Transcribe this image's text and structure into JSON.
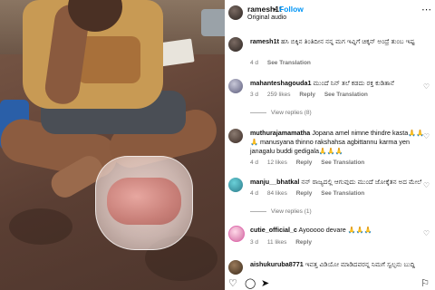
{
  "post": {
    "owner": "ramesh1t",
    "separator": "•",
    "follow_label": "Follow",
    "audio": "Original audio",
    "more_icon": "more-icon"
  },
  "comments": [
    {
      "user": "ramesh1t",
      "text": "ಹಸಿ ಬಿಕ್ಕಿನ ತಿಂತಿದೀನ ನನ್ನ ಮಗ ಇವ್ನಿಗೆ ಚಿಕ್ಕನ್ ಅಂದ್ರೆ ತುಂಬ ಇಷ್ಟ",
      "time": "4 d",
      "likes": "",
      "reply": "",
      "see_translation": "See Translation"
    },
    {
      "user": "mahanteshagouda1",
      "text": "ಮುಂದೆ ನಿನ್ ತಲೆ ಕಡದು ರಕ್ತ ಕುಡಿತಾನೆ",
      "time": "3 d",
      "likes": "259 likes",
      "reply": "Reply",
      "see_translation": "See Translation",
      "view_replies": "View replies (8)"
    },
    {
      "user": "muthurajamamatha",
      "text": "Jopana amel nimne thindre kasta🙏🙏🙏 manusyana thinno rakshahsa agbittannu karma yen janagalu buddi gedigala🙏🙏🙏",
      "time": "4 d",
      "likes": "12 likes",
      "reply": "Reply",
      "see_translation": "See Translation"
    },
    {
      "user": "manju__bhatkal",
      "text": "ನನ್ ರಾಜ್ಯದಲ್ಲಿ ಆಗುವುದು ಮುಂದೆ ಜೋಕ್ಕೆತನ ಅದ ಮೇಲೆ",
      "time": "4 d",
      "likes": "84 likes",
      "reply": "Reply",
      "see_translation": "See Translation",
      "view_replies": "View replies (1)"
    },
    {
      "user": "cutie_official_c",
      "text": "Ayooooo devare 🙏🙏🙏",
      "time": "3 d",
      "likes": "11 likes",
      "reply": "Reply",
      "see_translation": ""
    },
    {
      "user": "aishukuruba8771",
      "text": "ಇವತ್ತ ವಿಡಿಯೋ ಮಾಡಿದವರನ್ನ ನಿಮಗೆ ಸ್ವಲ್ಪನು ಬುದ್ದಿ",
      "time": "",
      "likes": "",
      "reply": "",
      "see_translation": ""
    }
  ],
  "footer": {
    "like_icon": "heart-icon",
    "comment_icon": "comment-icon",
    "share_icon": "share-icon",
    "save_icon": "bookmark-icon"
  }
}
